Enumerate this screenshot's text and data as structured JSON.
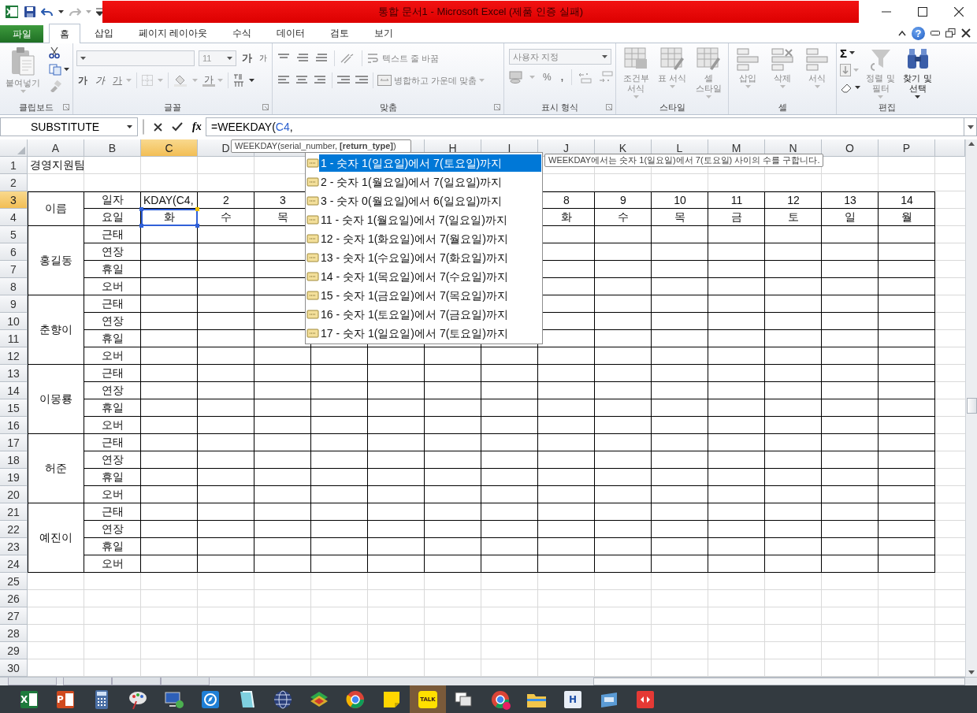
{
  "title_bar": {
    "title": "통합 문서1  -  Microsoft Excel (제품 인증 실패)"
  },
  "ribbon_tabs": [
    {
      "label": "파일",
      "kind": "file",
      "selected": false
    },
    {
      "label": "홈",
      "kind": "tab",
      "selected": true
    },
    {
      "label": "삽입",
      "kind": "tab",
      "selected": false
    },
    {
      "label": "페이지 레이아웃",
      "kind": "tab",
      "selected": false
    },
    {
      "label": "수식",
      "kind": "tab",
      "selected": false
    },
    {
      "label": "데이터",
      "kind": "tab",
      "selected": false
    },
    {
      "label": "검토",
      "kind": "tab",
      "selected": false
    },
    {
      "label": "보기",
      "kind": "tab",
      "selected": false
    }
  ],
  "help": "?",
  "ribbon": {
    "clipboard": {
      "label": "클립보드",
      "paste": {
        "label": "붙여넣기",
        "disabled": true
      }
    },
    "font": {
      "label": "글꼴",
      "size": "11",
      "grow": "가",
      "shrink": "가",
      "bold": "가",
      "italic": "가",
      "underline": "가",
      "font_color": "가"
    },
    "alignment": {
      "label": "맞춤",
      "wrap_text": {
        "label": "텍스트 줄 바꿈",
        "disabled": true
      },
      "merge": {
        "label": "병합하고 가운데 맞춤",
        "disabled": true
      }
    },
    "number": {
      "label": "표시 형식",
      "format": "사용자 지정",
      "percent": "%",
      "comma": ","
    },
    "styles": {
      "label": "스타일",
      "buttons": [
        {
          "label": "조건부 서식",
          "disabled": true
        },
        {
          "label": "표 서식",
          "disabled": true
        },
        {
          "label": "셀 스타일",
          "disabled": true
        }
      ]
    },
    "cells": {
      "label": "셀",
      "buttons": [
        {
          "label": "삽입",
          "disabled": true
        },
        {
          "label": "삭제",
          "disabled": true
        },
        {
          "label": "서식",
          "disabled": true
        }
      ]
    },
    "editing": {
      "label": "편집",
      "autosum": "Σ",
      "buttons": [
        {
          "label": "정렬 및 필터",
          "disabled": true
        },
        {
          "label": "찾기 및 선택",
          "disabled": false
        }
      ]
    }
  },
  "formula_bar": {
    "name_box": "SUBSTITUTE",
    "fx": "fx",
    "formula": [
      {
        "text": "=WEEKDAY(",
        "kind": "plain"
      },
      {
        "text": "C4",
        "kind": "reference"
      },
      {
        "text": ",",
        "kind": "plain"
      }
    ]
  },
  "sheet": {
    "columns_left": [
      {
        "label": "A",
        "selected": false
      },
      {
        "label": "B",
        "selected": false
      },
      {
        "label": "C",
        "selected": true
      },
      {
        "label": "D",
        "selected": false
      },
      {
        "selected": false
      }
    ],
    "columns_right": [
      {
        "label": "H",
        "selected": false
      },
      {
        "label": "I",
        "selected": false
      },
      {
        "label": "J",
        "selected": false
      },
      {
        "label": "K",
        "selected": false
      },
      {
        "label": "L",
        "selected": false
      },
      {
        "label": "M",
        "selected": false
      },
      {
        "label": "N",
        "selected": false
      },
      {
        "label": "O",
        "selected": false
      },
      {
        "label": "P",
        "selected": false
      },
      {
        "selected": false
      }
    ],
    "rows": [
      {
        "label": "1",
        "selected": false
      },
      {
        "label": "2",
        "selected": false
      },
      {
        "label": "3",
        "selected": true
      },
      {
        "label": "4",
        "selected": false
      },
      {
        "label": "5",
        "selected": false
      },
      {
        "label": "6",
        "selected": false
      },
      {
        "label": "7",
        "selected": false
      },
      {
        "label": "8",
        "selected": false
      },
      {
        "label": "9",
        "selected": false
      },
      {
        "label": "10",
        "selected": false
      },
      {
        "label": "11",
        "selected": false
      },
      {
        "label": "12",
        "selected": false
      },
      {
        "label": "13",
        "selected": false
      },
      {
        "label": "14",
        "selected": false
      },
      {
        "label": "15",
        "selected": false
      },
      {
        "label": "16",
        "selected": false
      },
      {
        "label": "17",
        "selected": false
      },
      {
        "label": "18",
        "selected": false
      },
      {
        "label": "19",
        "selected": false
      },
      {
        "label": "20",
        "selected": false
      },
      {
        "label": "21",
        "selected": false
      },
      {
        "label": "22",
        "selected": false
      },
      {
        "label": "23",
        "selected": false
      },
      {
        "label": "24",
        "selected": false
      },
      {
        "label": "25",
        "selected": false
      },
      {
        "label": "26",
        "selected": false
      },
      {
        "label": "27",
        "selected": false
      },
      {
        "label": "28",
        "selected": false
      },
      {
        "label": "29",
        "selected": false
      },
      {
        "label": "30",
        "selected": false
      }
    ],
    "title_cell": "경영지원팀",
    "schedule": {
      "name_label": "이름",
      "date_label": "일자",
      "day_label": "요일",
      "dates_left": [
        {
          "text": "KDAY(C4,",
          "editing": true
        },
        {
          "text": "2",
          "editing": false
        },
        {
          "text": "3",
          "editing": false
        }
      ],
      "dates_right": [
        {
          "text": "8",
          "editing": false
        },
        {
          "text": "9",
          "editing": false
        },
        {
          "text": "10",
          "editing": false
        },
        {
          "text": "11",
          "editing": false
        },
        {
          "text": "12",
          "editing": false
        },
        {
          "text": "13",
          "editing": false
        },
        {
          "text": "14",
          "editing": false
        }
      ],
      "days_left": [
        {
          "text": "화",
          "referenced": true
        },
        {
          "text": "수",
          "referenced": false
        },
        {
          "text": "목",
          "referenced": false
        }
      ],
      "days_right": [
        {
          "text": "화",
          "referenced": false
        },
        {
          "text": "수",
          "referenced": false
        },
        {
          "text": "목",
          "referenced": false
        },
        {
          "text": "금",
          "referenced": false
        },
        {
          "text": "토",
          "referenced": false
        },
        {
          "text": "일",
          "referenced": false
        },
        {
          "text": "월",
          "referenced": false
        }
      ],
      "people": [
        {
          "name": "홍길동",
          "categories": [
            "근태",
            "연장",
            "휴일",
            "오버"
          ]
        },
        {
          "name": "춘향이",
          "categories": [
            "근태",
            "연장",
            "휴일",
            "오버"
          ]
        },
        {
          "name": "이몽룡",
          "categories": [
            "근태",
            "연장",
            "휴일",
            "오버"
          ]
        },
        {
          "name": "허준",
          "categories": [
            "근태",
            "연장",
            "휴일",
            "오버"
          ]
        },
        {
          "name": "예진이",
          "categories": [
            "근태",
            "연장",
            "휴일",
            "오버"
          ]
        }
      ]
    }
  },
  "function_tooltip": "WEEKDAY(serial_number, **[return_type]**)",
  "autocomplete": {
    "items": [
      {
        "label": "1 - 숫자 1(일요일)에서 7(토요일)까지",
        "selected": true
      },
      {
        "label": "2 - 숫자 1(월요일)에서 7(일요일)까지",
        "selected": false
      },
      {
        "label": "3 - 숫자 0(월요일)에서 6(일요일)까지",
        "selected": false
      },
      {
        "label": "11 - 숫자 1(월요일)에서 7(일요일)까지",
        "selected": false
      },
      {
        "label": "12 - 숫자 1(화요일)에서 7(월요일)까지",
        "selected": false
      },
      {
        "label": "13 - 숫자 1(수요일)에서 7(화요일)까지",
        "selected": false
      },
      {
        "label": "14 - 숫자 1(목요일)에서 7(수요일)까지",
        "selected": false
      },
      {
        "label": "15 - 숫자 1(금요일)에서 7(목요일)까지",
        "selected": false
      },
      {
        "label": "16 - 숫자 1(토요일)에서 7(금요일)까지",
        "selected": false
      },
      {
        "label": "17 - 숫자 1(일요일)에서 7(토요일)까지",
        "selected": false
      }
    ]
  },
  "description_tooltip": "WEEKDAY에서는 숫자 1(일요일)에서 7(토요일) 사이의 수를 구합니다.",
  "taskbar": {
    "items": [
      {
        "label": "X",
        "selected": false
      },
      {
        "label": "P",
        "selected": false
      },
      {
        "selected": false
      },
      {
        "selected": false
      },
      {
        "selected": false
      },
      {
        "selected": false
      },
      {
        "selected": false
      },
      {
        "selected": false
      },
      {
        "selected": false
      },
      {
        "selected": false
      },
      {
        "selected": false
      },
      {
        "label": "TALK",
        "selected": true
      },
      {
        "selected": false
      },
      {
        "selected": false
      },
      {
        "selected": false
      },
      {
        "label": "H",
        "selected": false
      },
      {
        "selected": false
      },
      {
        "selected": false
      }
    ]
  }
}
